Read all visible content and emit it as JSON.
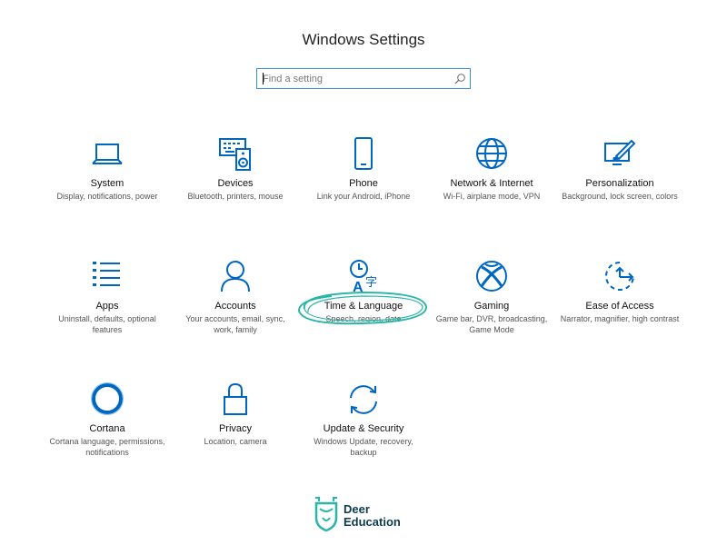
{
  "window": {
    "title": "Windows Settings"
  },
  "search": {
    "placeholder": "Find a setting",
    "icon": "search-icon"
  },
  "tiles": [
    {
      "name": "System",
      "desc": "Display, notifications, power",
      "icon": "laptop-icon"
    },
    {
      "name": "Devices",
      "desc": "Bluetooth, printers, mouse",
      "icon": "keyboard-speaker-icon"
    },
    {
      "name": "Phone",
      "desc": "Link your Android, iPhone",
      "icon": "phone-icon"
    },
    {
      "name": "Network & Internet",
      "desc": "Wi-Fi, airplane mode, VPN",
      "icon": "globe-icon"
    },
    {
      "name": "Personalization",
      "desc": "Background, lock screen, colors",
      "icon": "paint-brush-icon"
    },
    {
      "name": "Apps",
      "desc": "Uninstall, defaults, optional features",
      "icon": "apps-list-icon"
    },
    {
      "name": "Accounts",
      "desc": "Your accounts, email, sync, work, family",
      "icon": "person-icon"
    },
    {
      "name": "Time & Language",
      "desc": "Speech, region, date",
      "icon": "time-language-icon"
    },
    {
      "name": "Gaming",
      "desc": "Game bar, DVR, broadcasting, Game Mode",
      "icon": "xbox-icon"
    },
    {
      "name": "Ease of Access",
      "desc": "Narrator, magnifier, high contrast",
      "icon": "ease-of-access-icon"
    },
    {
      "name": "Cortana",
      "desc": "Cortana language, permissions, notifications",
      "icon": "cortana-icon"
    },
    {
      "name": "Privacy",
      "desc": "Location, camera",
      "icon": "lock-icon"
    },
    {
      "name": "Update & Security",
      "desc": "Windows Update, recovery, backup",
      "icon": "sync-icon"
    }
  ],
  "watermark": {
    "line1": "Deer",
    "line2": "Education"
  },
  "colors": {
    "accent": "#0067c0",
    "annotation": "#2bb5a6",
    "logo": "#0d3b4a"
  }
}
